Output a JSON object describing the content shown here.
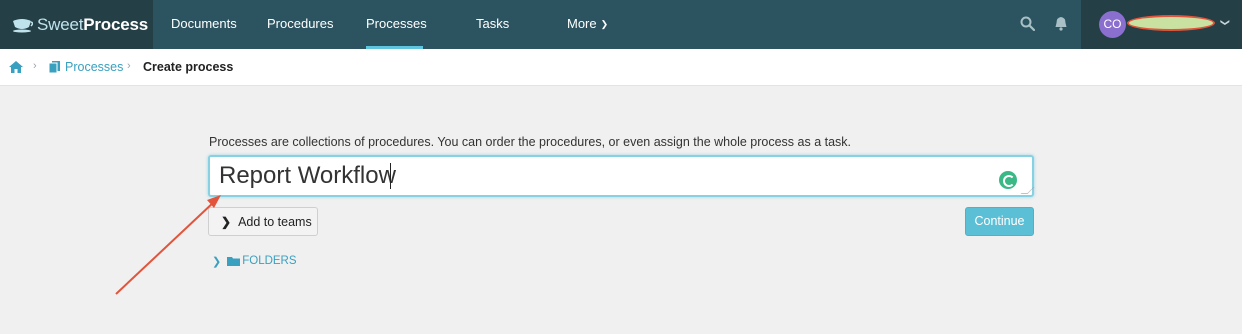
{
  "brand": {
    "sweet": "Sweet",
    "process": "Process"
  },
  "nav": {
    "items": [
      {
        "label": "Documents"
      },
      {
        "label": "Procedures"
      },
      {
        "label": "Processes",
        "active": true
      },
      {
        "label": "Tasks"
      },
      {
        "label": "More"
      }
    ],
    "search_icon": "search-icon",
    "bell_icon": "bell-icon"
  },
  "user": {
    "initials": "CO"
  },
  "breadcrumb": {
    "home_icon": "home-icon",
    "processes_label": "Processes",
    "current": "Create process"
  },
  "form": {
    "intro": "Processes are collections of procedures. You can order the procedures, or even assign the whole process as a task.",
    "name_value": "Report Workflow",
    "add_to_teams_label": "Add to teams",
    "continue_label": "Continue",
    "folders_label": "FOLDERS"
  },
  "colors": {
    "nav_bg": "#2c5460",
    "brand_bg": "#253f47",
    "accent": "#5bbfd6",
    "link": "#3aa0bf",
    "annotation": "#e2543b"
  }
}
